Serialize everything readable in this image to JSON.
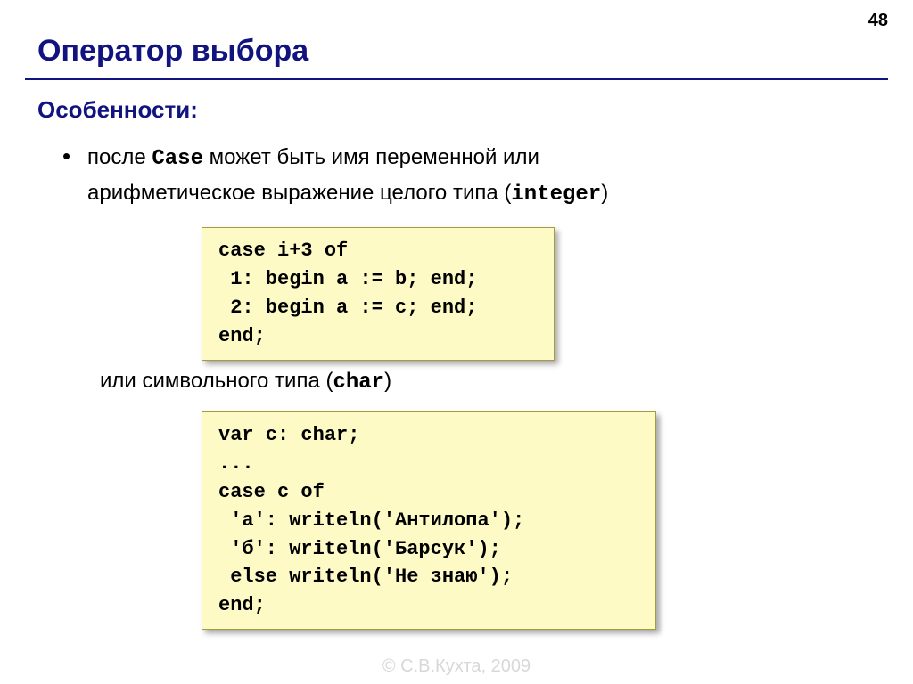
{
  "page_number": "48",
  "title": "Оператор выбора",
  "subtitle": "Особенности:",
  "bullet": {
    "pre": "после ",
    "kw1": "Case",
    "mid1": " может быть имя переменной или",
    "line2a": "арифметическое выражение целого типа (",
    "kw2": "integer",
    "line2b": ")"
  },
  "code1": "case i+3 of\n 1: begin a := b; end;\n 2: begin a := c; end;\nend;",
  "after_code1": {
    "pre": "или символьного типа (",
    "kw": "char",
    "post": ")"
  },
  "code2": "var c: char;\n...\ncase c of\n 'а': writeln('Антилопа');\n 'б': writeln('Барсук');\n else writeln('Не знаю');\nend;",
  "footer": "© С.В.Кухта, 2009"
}
